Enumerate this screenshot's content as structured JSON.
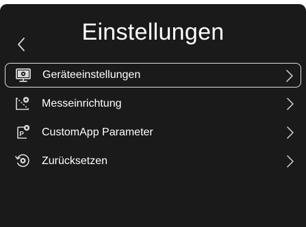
{
  "header": {
    "title": "Einstellungen",
    "back_icon": "chevron-left-icon"
  },
  "menu": {
    "items": [
      {
        "label": "Geräteeinstellungen",
        "icon": "monitor-gear-icon",
        "selected": true
      },
      {
        "label": "Messeinrichtung",
        "icon": "measurement-gear-icon",
        "selected": false
      },
      {
        "label": "CustomApp Parameter",
        "icon": "parameter-gear-icon",
        "selected": false
      },
      {
        "label": "Zurücksetzen",
        "icon": "reset-gear-icon",
        "selected": false
      }
    ]
  },
  "colors": {
    "background": "#1a1a1a",
    "text": "#ffffff",
    "icon": "#d8d8d8",
    "selection_border": "#e0e0e0"
  }
}
